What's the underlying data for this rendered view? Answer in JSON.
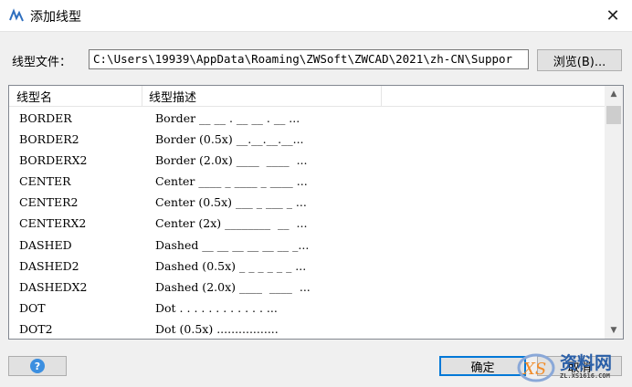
{
  "window": {
    "title": "添加线型",
    "close_glyph": "✕"
  },
  "file": {
    "label": "线型文件：",
    "value": "C:\\Users\\19939\\AppData\\Roaming\\ZWSoft\\ZWCAD\\2021\\zh-CN\\Suppor"
  },
  "browse_label": "浏览(B)...",
  "list": {
    "columns": [
      "线型名",
      "线型描述"
    ],
    "rows": [
      {
        "name": "BORDER",
        "desc": "Border __ __ . __ __ . __ ..."
      },
      {
        "name": "BORDER2",
        "desc": "Border (0.5x) __.__.__.__..."
      },
      {
        "name": "BORDERX2",
        "desc": "Border (2.0x) ____  ____  ..."
      },
      {
        "name": "CENTER",
        "desc": "Center ____ _ ____ _ ____ ..."
      },
      {
        "name": "CENTER2",
        "desc": "Center (0.5x) ___ _ ___ _ ..."
      },
      {
        "name": "CENTERX2",
        "desc": "Center (2x) ________  __  ..."
      },
      {
        "name": "DASHED",
        "desc": "Dashed __ __ __ __ __ __ _..."
      },
      {
        "name": "DASHED2",
        "desc": "Dashed (0.5x) _ _ _ _ _ _ ..."
      },
      {
        "name": "DASHEDX2",
        "desc": "Dashed (2.0x) ____  ____  ..."
      },
      {
        "name": "DOT",
        "desc": "Dot . . . . . . . . . . . . ..."
      },
      {
        "name": "DOT2",
        "desc": "Dot (0.5x) ................."
      }
    ]
  },
  "buttons": {
    "help_glyph": "?",
    "ok": "确定",
    "cancel": "取消"
  },
  "watermark": {
    "line1": "资料网",
    "line2": "ZL.XS1616.COM"
  },
  "colors": {
    "accent": "#0078d7",
    "help": "#3c8fe0",
    "watermark": "#2a5fa8"
  }
}
